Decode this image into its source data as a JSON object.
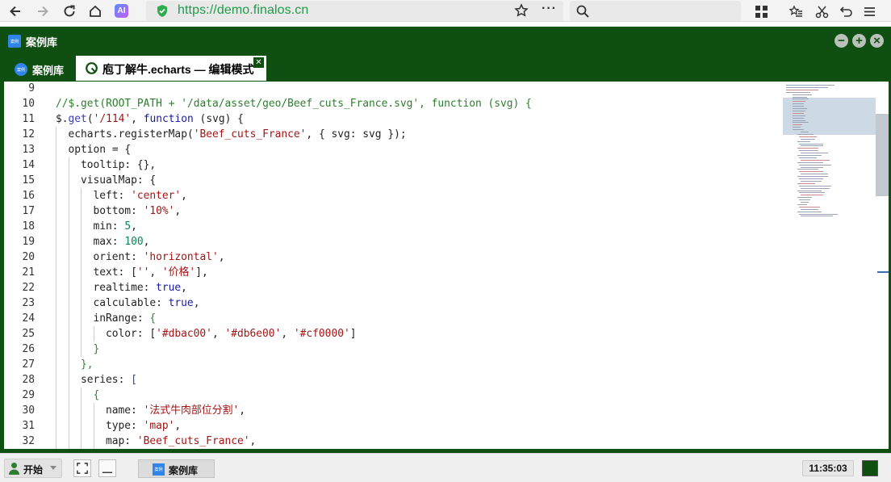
{
  "browser": {
    "url": "https://demo.finalos.cn",
    "ai_icon_text": "AI",
    "more_text": "···"
  },
  "window": {
    "title": "案例库",
    "icon_text": "案例",
    "tabs": [
      {
        "label": "案例库",
        "icon_text": "案例"
      },
      {
        "label": "庖丁解牛.echarts — 编辑模式",
        "close": "✕"
      }
    ]
  },
  "editor": {
    "lines": [
      {
        "n": "9",
        "indent": 0,
        "tokens": []
      },
      {
        "n": "10",
        "indent": 0,
        "tokens": [
          [
            "com",
            "//$.get(ROOT_PATH + '/data/asset/geo/Beef_cuts_France.svg', function (svg) {"
          ]
        ]
      },
      {
        "n": "11",
        "indent": 0,
        "tokens": [
          [
            "txt",
            "$."
          ],
          [
            "fn",
            "get"
          ],
          [
            "txt",
            "("
          ],
          [
            "str",
            "'/114'"
          ],
          [
            "txt",
            ", "
          ],
          [
            "kw",
            "function"
          ],
          [
            "txt",
            " (svg) {"
          ]
        ]
      },
      {
        "n": "12",
        "indent": 1,
        "tokens": [
          [
            "txt",
            "echarts.registerMap("
          ],
          [
            "str",
            "'Beef_cuts_France'"
          ],
          [
            "txt",
            ", { svg: svg });"
          ]
        ]
      },
      {
        "n": "13",
        "indent": 1,
        "tokens": [
          [
            "txt",
            "option = {"
          ]
        ]
      },
      {
        "n": "14",
        "indent": 2,
        "tokens": [
          [
            "txt",
            "tooltip: {},"
          ]
        ]
      },
      {
        "n": "15",
        "indent": 2,
        "tokens": [
          [
            "txt",
            "visualMap: {"
          ]
        ]
      },
      {
        "n": "16",
        "indent": 3,
        "tokens": [
          [
            "txt",
            "left: "
          ],
          [
            "str",
            "'center'"
          ],
          [
            "txt",
            ","
          ]
        ]
      },
      {
        "n": "17",
        "indent": 3,
        "tokens": [
          [
            "txt",
            "bottom: "
          ],
          [
            "str",
            "'10%'"
          ],
          [
            "txt",
            ","
          ]
        ]
      },
      {
        "n": "18",
        "indent": 3,
        "tokens": [
          [
            "txt",
            "min: "
          ],
          [
            "num",
            "5"
          ],
          [
            "txt",
            ","
          ]
        ]
      },
      {
        "n": "19",
        "indent": 3,
        "tokens": [
          [
            "txt",
            "max: "
          ],
          [
            "num",
            "100"
          ],
          [
            "txt",
            ","
          ]
        ]
      },
      {
        "n": "20",
        "indent": 3,
        "tokens": [
          [
            "txt",
            "orient: "
          ],
          [
            "str",
            "'horizontal'"
          ],
          [
            "txt",
            ","
          ]
        ]
      },
      {
        "n": "21",
        "indent": 3,
        "tokens": [
          [
            "txt",
            "text: ["
          ],
          [
            "str",
            "''"
          ],
          [
            "txt",
            ", "
          ],
          [
            "str",
            "'价格'"
          ],
          [
            "txt",
            "],"
          ]
        ]
      },
      {
        "n": "22",
        "indent": 3,
        "tokens": [
          [
            "txt",
            "realtime: "
          ],
          [
            "kw",
            "true"
          ],
          [
            "txt",
            ","
          ]
        ]
      },
      {
        "n": "23",
        "indent": 3,
        "tokens": [
          [
            "txt",
            "calculable: "
          ],
          [
            "kw",
            "true"
          ],
          [
            "txt",
            ","
          ]
        ]
      },
      {
        "n": "24",
        "indent": 3,
        "tokens": [
          [
            "txt",
            "inRange: "
          ],
          [
            "br",
            "{"
          ]
        ]
      },
      {
        "n": "25",
        "indent": 4,
        "tokens": [
          [
            "txt",
            "color: ["
          ],
          [
            "str",
            "'#dbac00'"
          ],
          [
            "txt",
            ", "
          ],
          [
            "str",
            "'#db6e00'"
          ],
          [
            "txt",
            ", "
          ],
          [
            "str",
            "'#cf0000'"
          ],
          [
            "txt",
            "]"
          ]
        ]
      },
      {
        "n": "26",
        "indent": 3,
        "tokens": [
          [
            "br",
            "}"
          ]
        ]
      },
      {
        "n": "27",
        "indent": 2,
        "tokens": [
          [
            "br",
            "},"
          ]
        ]
      },
      {
        "n": "28",
        "indent": 2,
        "tokens": [
          [
            "txt",
            "series: "
          ],
          [
            "brb",
            "["
          ]
        ]
      },
      {
        "n": "29",
        "indent": 3,
        "tokens": [
          [
            "br",
            "{"
          ]
        ]
      },
      {
        "n": "30",
        "indent": 4,
        "tokens": [
          [
            "txt",
            "name: "
          ],
          [
            "str",
            "'法式牛肉部位分割'"
          ],
          [
            "txt",
            ","
          ]
        ]
      },
      {
        "n": "31",
        "indent": 4,
        "tokens": [
          [
            "txt",
            "type: "
          ],
          [
            "str",
            "'map'"
          ],
          [
            "txt",
            ","
          ]
        ]
      },
      {
        "n": "32",
        "indent": 4,
        "tokens": [
          [
            "txt",
            "map: "
          ],
          [
            "str",
            "'Beef_cuts_France'"
          ],
          [
            "txt",
            ","
          ]
        ]
      }
    ]
  },
  "taskbar": {
    "start_label": "开始",
    "task_label": "案例库",
    "task_icon_text": "案例",
    "clock": "11:35:03"
  },
  "colors": {
    "window_frame": "#0f4f12",
    "url_green": "#1e9c48",
    "accent_blue": "#2f86e8"
  }
}
